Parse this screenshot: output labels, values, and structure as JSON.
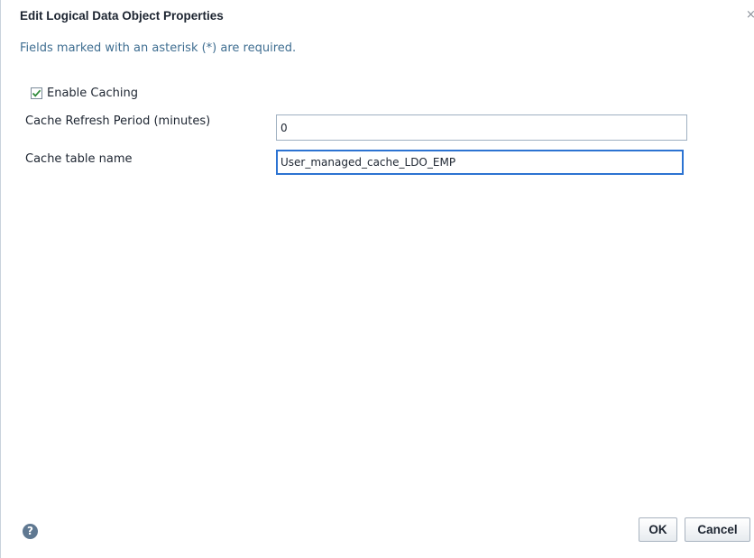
{
  "dialog": {
    "title": "Edit Logical Data Object Properties",
    "close_glyph": "×",
    "required_note": "Fields marked with an asterisk (*) are required."
  },
  "form": {
    "enable_caching": {
      "label": "Enable Caching",
      "checked": true
    },
    "cache_refresh_period": {
      "label": "Cache Refresh Period (minutes)",
      "value": "0"
    },
    "cache_table_name": {
      "label": "Cache table name",
      "value": "User_managed_cache_LDO_EMP"
    }
  },
  "footer": {
    "help_glyph": "?",
    "ok_label": "OK",
    "cancel_label": "Cancel"
  },
  "colors": {
    "accent": "#2c73d2",
    "note_text": "#3f6e91",
    "checkmark": "#2f8a3a"
  },
  "icons": {
    "close": "close-icon",
    "help": "help-icon",
    "checkmark": "checkmark-icon"
  }
}
